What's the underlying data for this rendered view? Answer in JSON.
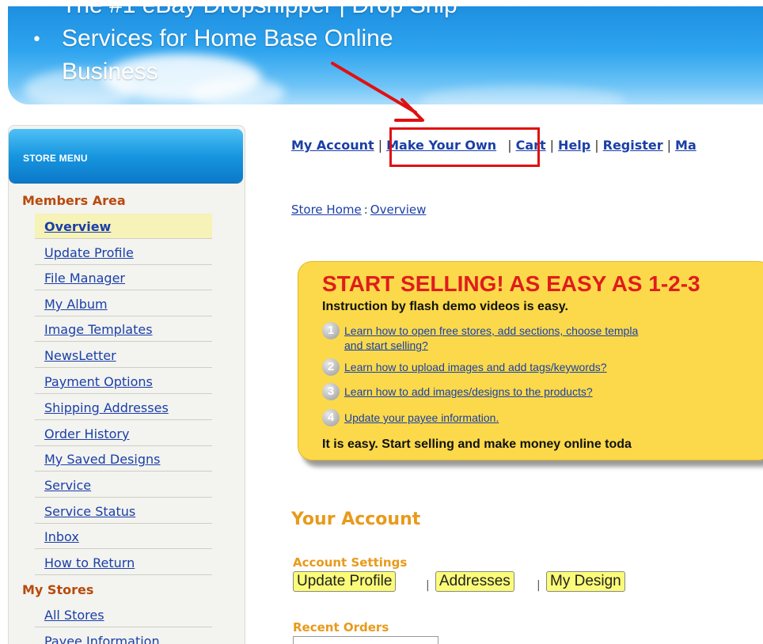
{
  "banner": {
    "title_line1": "The #1 eBay Dropshipper | Drop Ship",
    "title_line2": "Services for Home Base Online",
    "title_line3": "Business"
  },
  "top_nav": {
    "items": [
      "My Account",
      "Make Your Own",
      "Cart",
      "Help",
      "Register",
      "Ma"
    ],
    "separator": "|",
    "highlighted": "Make Your Own"
  },
  "breadcrumb": {
    "home": "Store Home",
    "separator": ":",
    "current": "Overview"
  },
  "sidebar": {
    "header": "STORE MENU",
    "sections": [
      {
        "title": "Members Area",
        "items": [
          "Overview",
          "Update Profile",
          "File Manager",
          "My Album",
          "Image Templates",
          "NewsLetter",
          "Payment Options",
          "Shipping Addresses",
          "Order History",
          "My Saved Designs",
          "Service",
          "Service Status",
          "Inbox",
          "How to Return"
        ],
        "active": "Overview"
      },
      {
        "title": "My Stores",
        "items": [
          "All Stores",
          "Payee Information"
        ]
      }
    ]
  },
  "promo": {
    "title": "START SELLING! AS EASY AS 1-2-3",
    "subtitle": "Instruction by flash demo videos is easy.",
    "steps": [
      {
        "number": "1",
        "line1": "Learn how to open free stores, add sections, choose templa",
        "line2": "and start selling?"
      },
      {
        "number": "2",
        "line1": "Learn how to upload images and add tags/keywords?"
      },
      {
        "number": "3",
        "line1": "Learn how to add images/designs to the products?"
      },
      {
        "number": "4",
        "line1": "Update your payee information."
      }
    ],
    "footer": "It is easy. Start selling and make money online toda"
  },
  "account": {
    "heading": "Your Account",
    "settings_label": "Account Settings",
    "buttons": [
      "Update Profile",
      "Addresses",
      "My Design"
    ],
    "button_separator": "|",
    "recent_orders_label": "Recent Orders"
  },
  "colors": {
    "banner_blue": "#2ea4ef",
    "link_blue": "#1a3fa8",
    "section_brown": "#b84a0e",
    "promo_yellow": "#fbd94a",
    "promo_red": "#e01c1c",
    "account_orange": "#e89a1a",
    "annotation_red": "#e01010",
    "active_item_bg": "#f6f2b8"
  }
}
